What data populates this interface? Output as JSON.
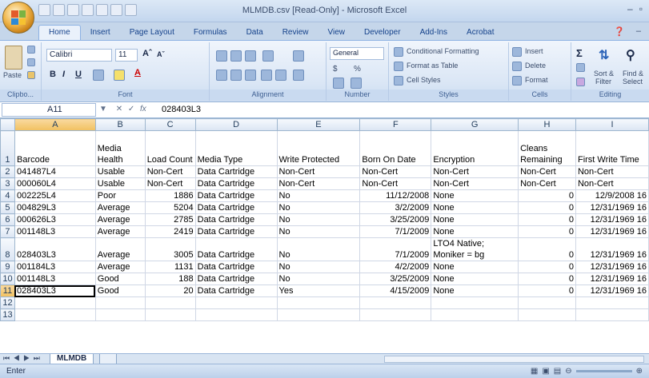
{
  "window": {
    "title": "MLMDB.csv  [Read-Only]  -  Microsoft Excel"
  },
  "tabs": [
    "Home",
    "Insert",
    "Page Layout",
    "Formulas",
    "Data",
    "Review",
    "View",
    "Developer",
    "Add-Ins",
    "Acrobat"
  ],
  "ribbon": {
    "clipboard": {
      "label": "Clipbo...",
      "paste": "Paste"
    },
    "font": {
      "label": "Font",
      "name": "Calibri",
      "size": "11",
      "bold": "B",
      "italic": "I",
      "underline": "U"
    },
    "alignment": {
      "label": "Alignment"
    },
    "number": {
      "label": "Number",
      "format": "General",
      "currency": "$",
      "percent": "%"
    },
    "styles": {
      "label": "Styles",
      "conditional": "Conditional Formatting",
      "table": "Format as Table",
      "cell": "Cell Styles"
    },
    "cells": {
      "label": "Cells",
      "insert": "Insert",
      "delete": "Delete",
      "format": "Format"
    },
    "editing": {
      "label": "Editing",
      "sort": "Sort &",
      "filter": "Filter",
      "find": "Find &",
      "select": "Select"
    }
  },
  "formula_bar": {
    "name_box": "A11",
    "fx": "fx",
    "content": "028403L3"
  },
  "columns": [
    "A",
    "B",
    "C",
    "D",
    "E",
    "F",
    "G",
    "H",
    "I"
  ],
  "rows": [
    {
      "n": "1",
      "cells": [
        "Barcode",
        "Media Health",
        "Load Count",
        "Media Type",
        "Write Protected",
        "Born On Date",
        "Encryption",
        "Cleans Remaining",
        "First Write Time"
      ]
    },
    {
      "n": "2",
      "cells": [
        "041487L4",
        "Usable",
        "Non-Cert",
        "Data Cartridge",
        "Non-Cert",
        "Non-Cert",
        "Non-Cert",
        "Non-Cert",
        "Non-Cert"
      ]
    },
    {
      "n": "3",
      "cells": [
        "000060L4",
        "Usable",
        "Non-Cert",
        "Data Cartridge",
        "Non-Cert",
        "Non-Cert",
        "Non-Cert",
        "Non-Cert",
        "Non-Cert"
      ]
    },
    {
      "n": "4",
      "cells": [
        "002225L4",
        "Poor",
        "1886",
        "Data Cartridge",
        "No",
        "11/12/2008",
        "None",
        "0",
        "12/9/2008 16"
      ]
    },
    {
      "n": "5",
      "cells": [
        "004829L3",
        "Average",
        "5204",
        "Data Cartridge",
        "No",
        "3/2/2009",
        "None",
        "0",
        "12/31/1969 16"
      ]
    },
    {
      "n": "6",
      "cells": [
        "000626L3",
        "Average",
        "2785",
        "Data Cartridge",
        "No",
        "3/25/2009",
        "None",
        "0",
        "12/31/1969 16"
      ]
    },
    {
      "n": "7",
      "cells": [
        "001148L3",
        "Average",
        "2419",
        "Data Cartridge",
        "No",
        "7/1/2009",
        "None",
        "0",
        "12/31/1969 16"
      ]
    },
    {
      "n": "8",
      "cells": [
        "028403L3",
        "Average",
        "3005",
        "Data Cartridge",
        "No",
        "7/1/2009",
        "LTO4 Native; Moniker = bg",
        "0",
        "12/31/1969 16"
      ]
    },
    {
      "n": "9",
      "cells": [
        "001184L3",
        "Average",
        "1131",
        "Data Cartridge",
        "No",
        "4/2/2009",
        "None",
        "0",
        "12/31/1969 16"
      ]
    },
    {
      "n": "10",
      "cells": [
        "001148L3",
        "Good",
        "188",
        "Data Cartridge",
        "No",
        "3/25/2009",
        "None",
        "0",
        "12/31/1969 16"
      ]
    },
    {
      "n": "11",
      "cells": [
        "028403L3",
        "Good",
        "20",
        "Data Cartridge",
        "Yes",
        "4/15/2009",
        "None",
        "0",
        "12/31/1969 16"
      ]
    },
    {
      "n": "12",
      "cells": [
        "",
        "",
        "",
        "",
        "",
        "",
        "",
        "",
        ""
      ]
    },
    {
      "n": "13",
      "cells": [
        "",
        "",
        "",
        "",
        "",
        "",
        "",
        "",
        ""
      ]
    }
  ],
  "sheet_tab": "MLMDB",
  "status": "Enter",
  "colors": {
    "accent": "#15428b",
    "selected_header": "#f1c15f"
  }
}
